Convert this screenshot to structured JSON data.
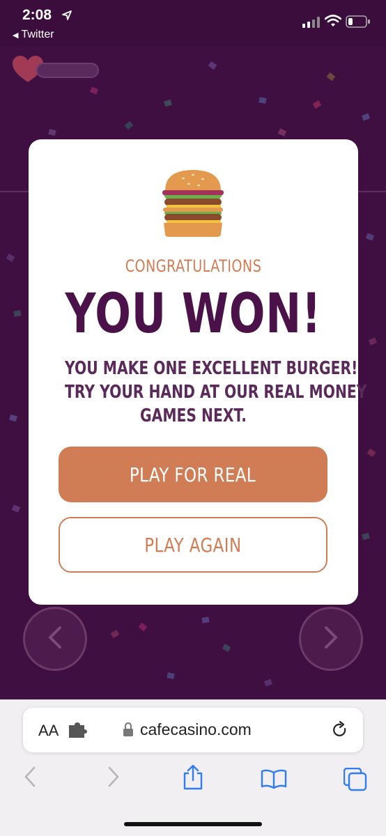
{
  "status_bar": {
    "time": "2:08",
    "back_app": "Twitter"
  },
  "modal": {
    "congrats": "CONGRATULATIONS",
    "headline": "YOU WON!",
    "message_lines": [
      "YOU MAKE ONE EXCELLENT BURGER!",
      "TRY YOUR HAND AT OUR REAL MONEY",
      "GAMES NEXT."
    ],
    "play_real_label": "PLAY FOR REAL",
    "play_again_label": "PLAY AGAIN"
  },
  "browser": {
    "text_size_label": "AA",
    "url": "cafecasino.com"
  },
  "colors": {
    "accent": "#d07d55",
    "headline": "#4a1248",
    "background": "#3f0f42"
  }
}
